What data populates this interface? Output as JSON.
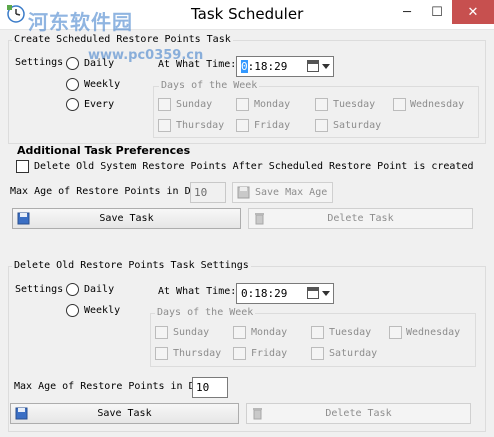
{
  "window": {
    "title": "Task Scheduler",
    "minimize": "─",
    "maximize": "☐",
    "close": "✕",
    "watermark_name": "河东软件园",
    "watermark_url": "www.pc0359.cn"
  },
  "create_section": {
    "title": "Create Scheduled Restore Points Task",
    "settings_label": "Settings",
    "options": [
      "Daily",
      "Weekly",
      "Every"
    ],
    "time_label": "At What Time:",
    "time_value_selected": "0",
    "time_value_rest": ":18:29",
    "days_title": "Days of the Week",
    "days": [
      "Sunday",
      "Monday",
      "Tuesday",
      "Wednesday",
      "Thursday",
      "Friday",
      "Saturday"
    ]
  },
  "additional": {
    "title": "Additional Task Preferences",
    "delete_label": "Delete Old System Restore Points After Scheduled Restore Point is created",
    "max_age_label": "Max Age of Restore Points in D",
    "max_age_value": "10",
    "save_max_age": "Save Max Age",
    "save_task": "Save Task",
    "delete_task": "Delete Task"
  },
  "delete_section": {
    "title": "Delete Old Restore Points Task Settings",
    "settings_label": "Settings",
    "options": [
      "Daily",
      "Weekly"
    ],
    "time_label": "At What Time:",
    "time_value": "0:18:29",
    "days_title": "Days of the Week",
    "days": [
      "Sunday",
      "Monday",
      "Tuesday",
      "Wednesday",
      "Thursday",
      "Friday",
      "Saturday"
    ],
    "max_age_label": "Max Age of Restore Points in D",
    "max_age_value": "10",
    "save_task": "Save Task",
    "delete_task": "Delete Task"
  },
  "colors": {
    "selection": "#3399ff",
    "close_button": "#c7504f",
    "watermark": "#3478c8"
  }
}
